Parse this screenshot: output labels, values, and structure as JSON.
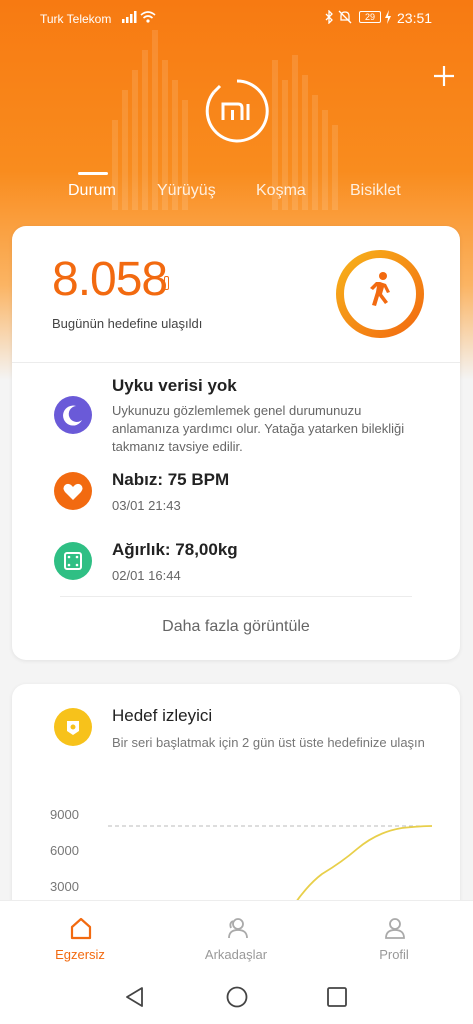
{
  "status_bar": {
    "carrier": "Turk Telekom",
    "battery": "29",
    "time": "23:51"
  },
  "tabs": [
    {
      "label": "Durum",
      "active": true
    },
    {
      "label": "Yürüyüş",
      "active": false
    },
    {
      "label": "Koşma",
      "active": false
    },
    {
      "label": "Bisiklet",
      "active": false
    }
  ],
  "summary": {
    "steps": "8.058",
    "goal_text": "Bugünün hedefine ulaşıldı"
  },
  "records": [
    {
      "title": "Uyku verisi yok",
      "subtitle": "Uykunuzu gözlemlemek genel durumunuzu anlamanıza yardımcı olur. Yatağa yatarken bilekliği takmanız tavsiye edilir.",
      "icon": "moon-icon",
      "color": "#6a5ad8"
    },
    {
      "title": "Nabız: 75 BPM",
      "subtitle": "03/01 21:43",
      "icon": "heart-icon",
      "color": "#f26a10"
    },
    {
      "title": "Ağırlık: 78,00kg",
      "subtitle": "02/01 16:44",
      "icon": "scale-icon",
      "color": "#2fbf84"
    }
  ],
  "more_label": "Daha fazla görüntüle",
  "goal_tracker": {
    "title": "Hedef izleyici",
    "subtitle": "Bir seri başlatmak için 2 gün üst üste hedefinize ulaşın",
    "icon": "badge-icon"
  },
  "chart_data": {
    "type": "line",
    "y_ticks": [
      "9000",
      "6000",
      "3000"
    ],
    "goal_line": 8000,
    "ylim": [
      0,
      9000
    ]
  },
  "bottom_nav": [
    {
      "label": "Egzersiz",
      "active": true,
      "icon": "home-icon"
    },
    {
      "label": "Arkadaşlar",
      "active": false,
      "icon": "friends-icon"
    },
    {
      "label": "Profil",
      "active": false,
      "icon": "profile-icon"
    }
  ],
  "colors": {
    "accent": "#f26a10",
    "hero_top": "#f77a12",
    "sleep": "#6a5ad8",
    "heart": "#f26a10",
    "weight": "#2fbf84",
    "goal_badge": "#f7c21b"
  }
}
